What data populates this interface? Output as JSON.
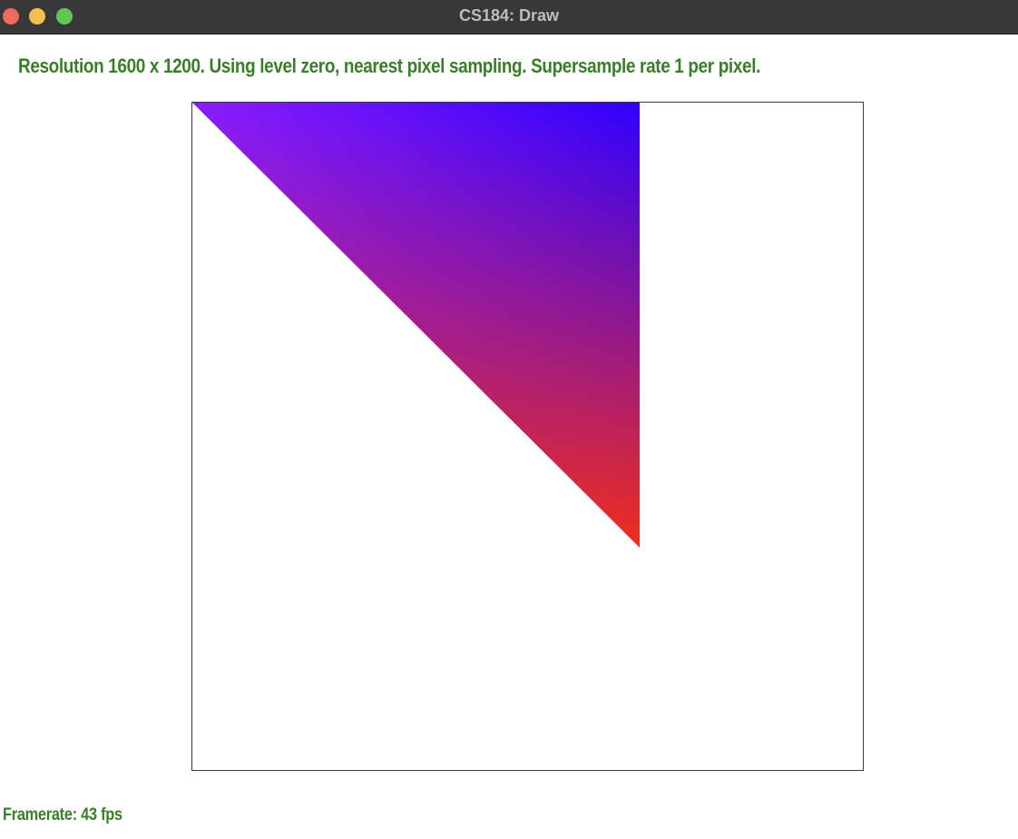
{
  "window": {
    "title": "CS184: Draw",
    "controls": [
      {
        "name": "close",
        "color": "#ed6a5e"
      },
      {
        "name": "minimize",
        "color": "#f5bf4f"
      },
      {
        "name": "zoom",
        "color": "#61c554"
      }
    ]
  },
  "status": {
    "text": "Resolution 1600 x 1200. Using level zero, nearest pixel sampling. Supersample rate 1 per pixel.",
    "color": "#3a7d2a"
  },
  "canvas": {
    "background": "#ffffff",
    "triangle": {
      "vertex_colors": {
        "top_left": "#8a1cff",
        "top_right": "#2e00ff",
        "bottom": "#f02e1c"
      }
    }
  },
  "framerate": {
    "text": "Framerate: 43 fps"
  }
}
